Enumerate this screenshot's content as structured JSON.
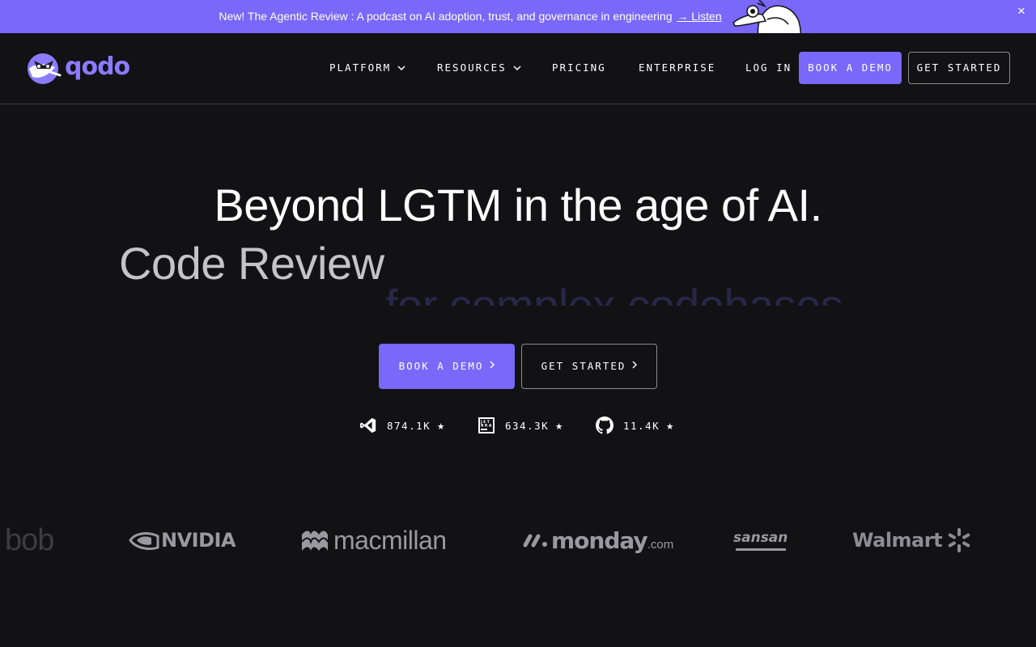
{
  "announcement": {
    "text": "New! The Agentic Review : A podcast on AI adoption, trust, and governance in engineering",
    "link": "→ Listen",
    "close": "✕"
  },
  "header": {
    "logo_text": "qodo",
    "nav": {
      "platform": "PLATFORM",
      "resources": "RESOURCES",
      "pricing": "PRICING",
      "enterprise": "ENTERPRISE",
      "login": "LOG IN"
    },
    "book_demo": "BOOK A DEMO",
    "get_started": "GET STARTED"
  },
  "hero": {
    "title": "Beyond LGTM in the age of AI.",
    "subtitle": "Code Review",
    "rotating_text": "for complex codebases",
    "book_demo": "BOOK A DEMO",
    "get_started": "GET STARTED"
  },
  "stats": [
    {
      "icon": "vscode-icon",
      "value": "874.1K",
      "star": "★"
    },
    {
      "icon": "jetbrains-icon",
      "value": "634.3K",
      "star": "★"
    },
    {
      "icon": "github-icon",
      "value": "11.4K",
      "star": "★"
    }
  ],
  "logos": {
    "bob": "bob",
    "nvidia": "NVIDIA",
    "macmillan": "macmillan",
    "monday": "monday",
    "monday_suffix": ".com",
    "sansan": "sansan",
    "walmart": "Walmart"
  },
  "colors": {
    "accent": "#7968fa",
    "background": "#121114",
    "logo_purple": "#8b7bff"
  }
}
